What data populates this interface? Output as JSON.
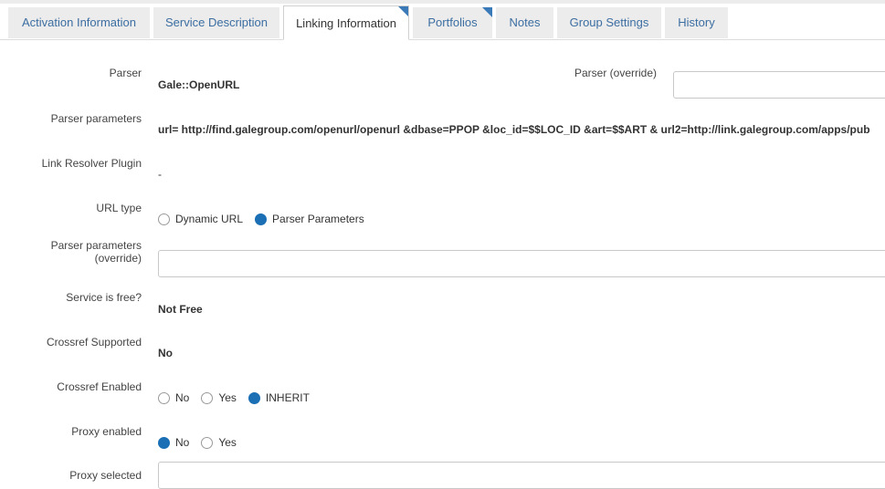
{
  "tabs": [
    {
      "label": "Activation Information",
      "active": false,
      "flag": false
    },
    {
      "label": "Service Description",
      "active": false,
      "flag": false
    },
    {
      "label": "Linking Information",
      "active": true,
      "flag": true
    },
    {
      "label": "Portfolios",
      "active": false,
      "flag": true
    },
    {
      "label": "Notes",
      "active": false,
      "flag": false
    },
    {
      "label": "Group Settings",
      "active": false,
      "flag": false
    },
    {
      "label": "History",
      "active": false,
      "flag": false
    }
  ],
  "fields": {
    "parser": {
      "label": "Parser",
      "value": "Gale::OpenURL"
    },
    "parser_override": {
      "label": "Parser (override)",
      "value": "",
      "placeholder": ""
    },
    "parser_parameters": {
      "label": "Parser parameters",
      "value": "url= http://find.galegroup.com/openurl/openurl &dbase=PPOP &loc_id=$$LOC_ID &art=$$ART & url2=http://link.galegroup.com/apps/pub"
    },
    "link_resolver_plugin": {
      "label": "Link Resolver Plugin",
      "value": "-"
    },
    "url_type": {
      "label": "URL type",
      "options": [
        "Dynamic URL",
        "Parser Parameters"
      ],
      "selected": "Parser Parameters"
    },
    "parser_parameters_override": {
      "label_line1": "Parser parameters",
      "label_line2": "(override)",
      "value": ""
    },
    "service_is_free": {
      "label": "Service is free?",
      "value": "Not Free"
    },
    "crossref_supported": {
      "label": "Crossref Supported",
      "value": "No"
    },
    "crossref_enabled": {
      "label": "Crossref Enabled",
      "options": [
        "No",
        "Yes",
        "INHERIT"
      ],
      "selected": "INHERIT"
    },
    "proxy_enabled": {
      "label": "Proxy enabled",
      "options": [
        "No",
        "Yes"
      ],
      "selected": "No"
    },
    "proxy_selected": {
      "label": "Proxy selected",
      "value": ""
    }
  },
  "colors": {
    "accent": "#1b6fb4",
    "tab_link": "#3c6ea2",
    "tab_bg": "#ececec"
  }
}
